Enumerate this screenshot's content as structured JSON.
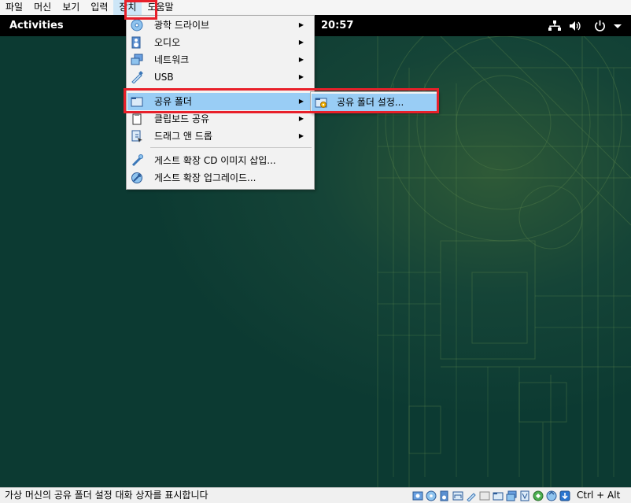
{
  "menubar": {
    "items": [
      {
        "label": "파일"
      },
      {
        "label": "머신"
      },
      {
        "label": "보기"
      },
      {
        "label": "입력"
      },
      {
        "label": "장치"
      },
      {
        "label": "도움말"
      }
    ],
    "active_index": 4
  },
  "guest": {
    "activities_label": "Activities",
    "clock": "20:57",
    "tray_icons": [
      "network-icon",
      "volume-icon",
      "power-icon",
      "chevron-down-icon"
    ]
  },
  "devices_menu": {
    "items": [
      {
        "label": "광학 드라이브",
        "icon": "optical-drive-icon",
        "submenu": true
      },
      {
        "label": "오디오",
        "icon": "audio-icon",
        "submenu": true
      },
      {
        "label": "네트워크",
        "icon": "network-adapter-icon",
        "submenu": true
      },
      {
        "label": "USB",
        "icon": "usb-icon",
        "submenu": true
      },
      {
        "label": "공유 폴더",
        "icon": "shared-folder-icon",
        "submenu": true,
        "highlighted": true
      },
      {
        "label": "클립보드 공유",
        "icon": "clipboard-icon",
        "submenu": true
      },
      {
        "label": "드래그 앤 드롭",
        "icon": "drag-drop-icon",
        "submenu": true
      },
      {
        "label": "게스트 확장 CD 이미지 삽입...",
        "icon": "guest-additions-cd-icon",
        "submenu": false
      },
      {
        "label": "게스트 확장 업그레이드...",
        "icon": "guest-additions-upgrade-icon",
        "submenu": false
      }
    ],
    "submenu_arrow": "▶"
  },
  "shared_folder_submenu": {
    "items": [
      {
        "label": "공유 폴더 설정...",
        "icon": "shared-folder-settings-icon",
        "highlighted": true
      }
    ]
  },
  "statusbar": {
    "text": "가상 머신의 공유 폴더 설정 대화 상자를 표시합니다",
    "host_key": "Ctrl + Alt"
  },
  "colors": {
    "highlight": "#99cdf5",
    "annotation_red": "#e8202a",
    "desktop_bg": "#0c3a32",
    "topbar_bg": "#000000"
  }
}
